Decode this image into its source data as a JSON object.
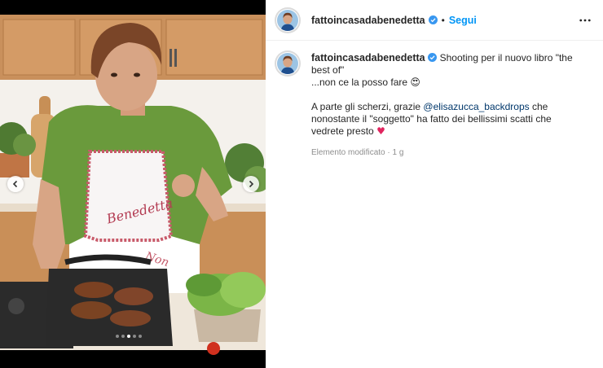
{
  "post": {
    "username": "fattoincasadabenedetta",
    "bullet": "•",
    "follow_label": "Segui",
    "more_icon": "more-horizontal-icon",
    "caption": {
      "line1": "Shooting per il nuovo libro \"the best of\"",
      "line2_text": "...non ce la posso fare",
      "line2_emoji": "😍",
      "line3_before": "A parte gli scherzi, grazie",
      "line3_mention": "@elisazucca_backdrops",
      "line3_after": "che nonostante il \"soggetto\" ha fatto dei bellissimi scatti che vedrete presto",
      "line3_emoji": "♥"
    },
    "meta": "Elemento modificato · 1 g"
  },
  "carousel": {
    "prev_icon": "chevron-left-icon",
    "next_icon": "chevron-right-icon",
    "dots": 5,
    "active_dot": 2,
    "apron_text_1": "Benedetta",
    "apron_text_2": "Non"
  },
  "colors": {
    "follow": "#0095f6",
    "mention": "#00376b",
    "verified": "#3897f0",
    "text": "#262626",
    "muted": "#8e8e8e"
  }
}
